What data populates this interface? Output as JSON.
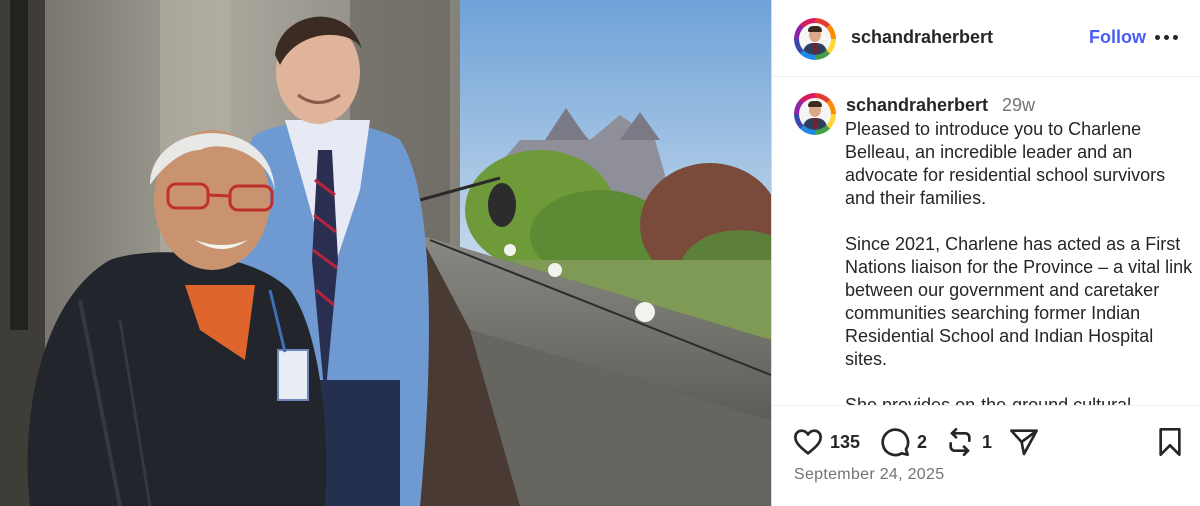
{
  "post": {
    "username": "schandraherbert",
    "follow_label": "Follow",
    "more_icon": "more-horizontal-icon",
    "time_ago": "29w",
    "caption": "Pleased to introduce you to Charlene Belleau, an incredible leader and an advocate for residential school survivors and their families.\n\nSince 2021, Charlene has acted as a First Nations liaison for the Province – a vital link between our government and caretaker communities searching former Indian Residential School and Indian Hospital sites.\n\nShe provides on-the-ground cultural",
    "likes": "135",
    "comments": "2",
    "reposts": "1",
    "date": "September 24, 2025"
  },
  "icons": {
    "like": "heart-icon",
    "comment": "comment-icon",
    "repost": "repost-icon",
    "share": "send-icon",
    "save": "bookmark-icon"
  },
  "colors": {
    "follow": "#4a5df9",
    "text": "#262626",
    "muted": "#737373",
    "border": "#dbdbdb"
  }
}
